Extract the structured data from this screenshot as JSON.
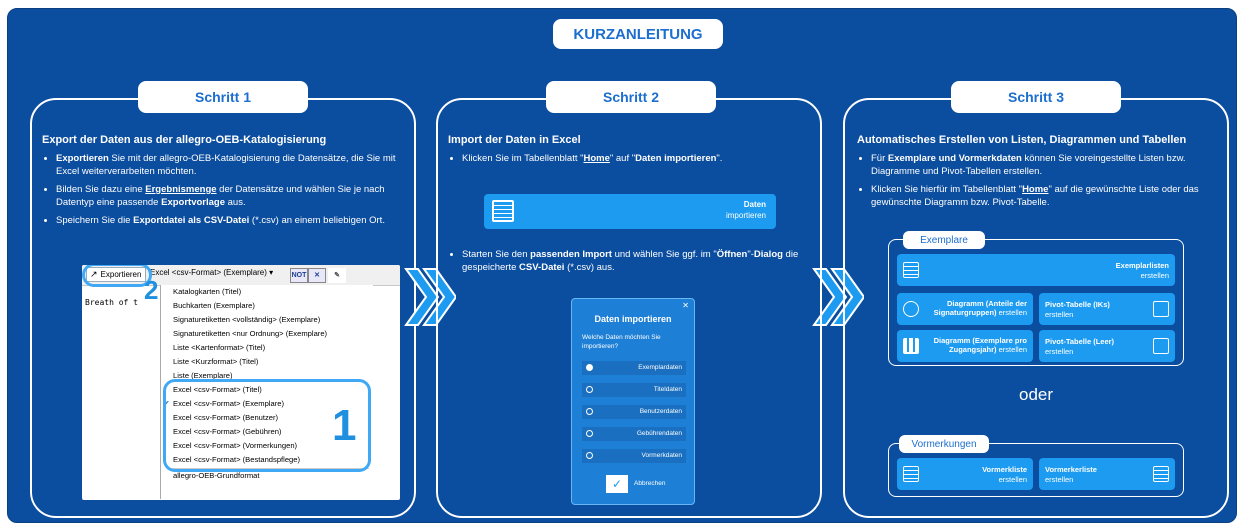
{
  "title": "KURZANLEITUNG",
  "colors": {
    "background": "#0b4d9e",
    "accent": "#1d9bf0",
    "highlight": "#3fa9f5",
    "pill_text": "#1c6fcf"
  },
  "step1": {
    "label": "Schritt 1",
    "heading": "Export der Daten aus der allegro-OEB-Katalogisierung",
    "b1_bold": "Exportieren",
    "b1_rest": " Sie mit der allegro-OEB-Katalogisierung die Datensätze, die Sie mit Excel weiterverarbeiten möchten.",
    "b2_pre": "Bilden Sie dazu eine ",
    "b2_link": "Ergebnismenge",
    "b2_mid": " der Datensätze und wählen Sie je nach Datentyp eine passende ",
    "b2_bold": "Exportvorlage",
    "b2_end": " aus.",
    "b3_pre": "Speichern Sie die ",
    "b3_bold": "Exportdatei als CSV-Datei",
    "b3_end": " (*.csv) an einem beliebigen Ort.",
    "shot": {
      "export_label": "Exportieren",
      "format_value": "Excel <csv-Format> (Exemplare)",
      "not_label": "NOT",
      "x_label": "✕",
      "breath_text": "Breath of t",
      "menu_items": [
        "Katalogkarten (Titel)",
        "Buchkarten (Exemplare)",
        "Signaturetiketten <vollständig> (Exemplare)",
        "Signaturetiketten <nur Ordnung> (Exemplare)",
        "Liste <Kartenformat> (Titel)",
        "Liste <Kurzformat> (Titel)",
        "Liste (Exemplare)",
        "Excel <csv-Format> (Titel)",
        "Excel <csv-Format> (Exemplare)",
        "Excel <csv-Format> (Benutzer)",
        "Excel <csv-Format> (Gebühren)",
        "Excel <csv-Format> (Vormerkungen)",
        "Excel <csv-Format> (Bestandspflege)",
        "allegro-OEB-Grundformat"
      ],
      "num1": "1",
      "num2": "2"
    }
  },
  "step2": {
    "label": "Schritt 2",
    "heading": "Import der Daten in Excel",
    "b1_pre": "Klicken Sie im Tabellenblatt \"",
    "b1_link": "Home",
    "b1_mid": "\" auf \"",
    "b1_bold": "Daten importieren",
    "b1_end": "\".",
    "button_title": "Daten",
    "button_sub": "importieren",
    "b2_pre": "Starten Sie den ",
    "b2_bold": "passenden Import",
    "b2_mid": " und wählen Sie ggf. im \"",
    "b2_bold2": "Öffnen",
    "b2_mid2": "\"-",
    "b2_bold3": "Dialog",
    "b2_mid3": " die gespeicherte ",
    "b2_bold4": "CSV-Datei",
    "b2_end": " (*.csv) aus.",
    "dialog": {
      "title": "Daten importieren",
      "question": "Welche Daten möchten Sie importieren?",
      "options": [
        "Exemplardaten",
        "Titeldaten",
        "Benutzerdaten",
        "Gebührendaten",
        "Vormerkdaten"
      ],
      "cancel": "Abbrechen"
    }
  },
  "step3": {
    "label": "Schritt 3",
    "heading": "Automatisches Erstellen von Listen, Diagrammen und Tabellen",
    "b1_pre": "Für ",
    "b1_bold": "Exemplare und Vormerkdaten",
    "b1_end": " können Sie voreingestellte Listen bzw. Diagramme und Pivot-Tabellen erstellen.",
    "b2_pre": "Klicken Sie hierfür im Tabellenblatt \"",
    "b2_link": "Home",
    "b2_end": "\" auf die gewünschte Liste oder das gewünschte Diagramm bzw. Pivot-Tabelle.",
    "group1": "Exemplare",
    "tile_exemplarlisten_t": "Exemplarlisten",
    "tile_exemplarlisten_s": "erstellen",
    "tile_diag1_t": "Diagramm (Anteile der Signaturgruppen)",
    "tile_diag1_s": "erstellen",
    "tile_pivot_iks_t": "Pivot-Tabelle (IKs)",
    "tile_pivot_iks_s": "erstellen",
    "tile_diag2_t": "Diagramm (Exemplare pro Zugangsjahr)",
    "tile_diag2_s": "erstellen",
    "tile_pivot_leer_t": "Pivot-Tabelle (Leer)",
    "tile_pivot_leer_s": "erstellen",
    "oder": "oder",
    "group2": "Vormerkungen",
    "tile_vl1_t": "Vormerkliste",
    "tile_vl1_s": "erstellen",
    "tile_vl2_t": "Vormerkerliste",
    "tile_vl2_s": "erstellen"
  }
}
